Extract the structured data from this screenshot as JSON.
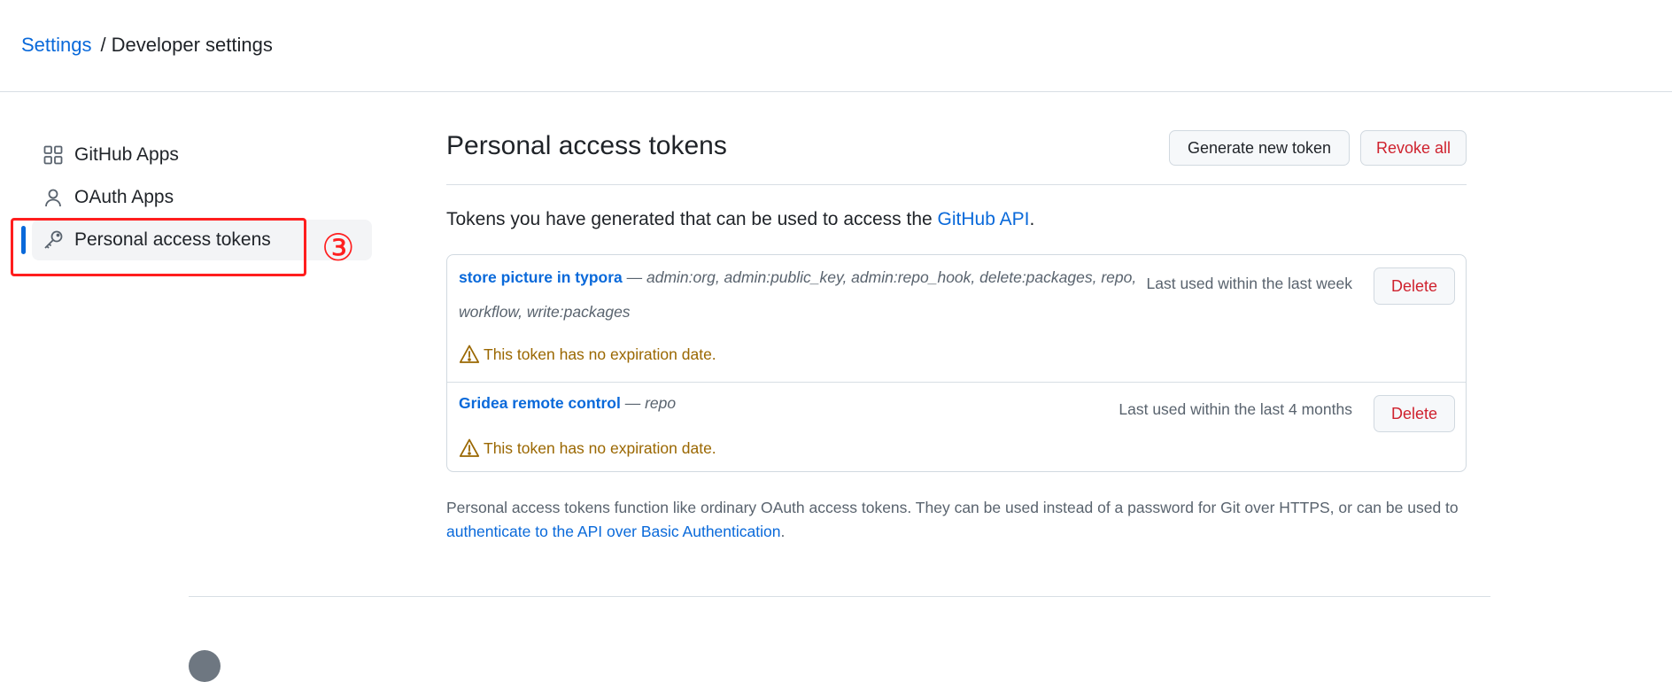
{
  "breadcrumb": {
    "settings_label": "Settings",
    "separator": "/",
    "current_label": "Developer settings"
  },
  "sidebar": {
    "items": [
      {
        "label": "GitHub Apps",
        "icon": "apps-icon",
        "active": false
      },
      {
        "label": "OAuth Apps",
        "icon": "person-icon",
        "active": false
      },
      {
        "label": "Personal access tokens",
        "icon": "key-icon",
        "active": true
      }
    ]
  },
  "annotation": {
    "label": "③",
    "color": "#ff1e1e"
  },
  "main": {
    "title": "Personal access tokens",
    "generate_label": "Generate new token",
    "revoke_label": "Revoke all",
    "intro_text": "Tokens you have generated that can be used to access the ",
    "intro_link": "GitHub API",
    "intro_end": ".",
    "tokens": [
      {
        "name": "store picture in typora",
        "dash": " — ",
        "scopes": "admin:org, admin:public_key, admin:repo_hook, delete:packages, repo, workflow, write:packages",
        "last_used": "Last used within the last week",
        "warning": "This token has no expiration date.",
        "delete_label": "Delete"
      },
      {
        "name": "Gridea remote control",
        "dash": " — ",
        "scopes": "repo",
        "last_used": "Last used within the last 4 months",
        "warning": "This token has no expiration date.",
        "delete_label": "Delete"
      }
    ],
    "footnote_text": "Personal access tokens function like ordinary OAuth access tokens. They can be used instead of a password for Git over HTTPS, or can be used to ",
    "footnote_link": "authenticate to the API over Basic Authentication",
    "footnote_end": "."
  },
  "colors": {
    "link": "#0969da",
    "danger": "#cf222e",
    "warning": "#9a6700",
    "active_bar": "#0969da"
  }
}
